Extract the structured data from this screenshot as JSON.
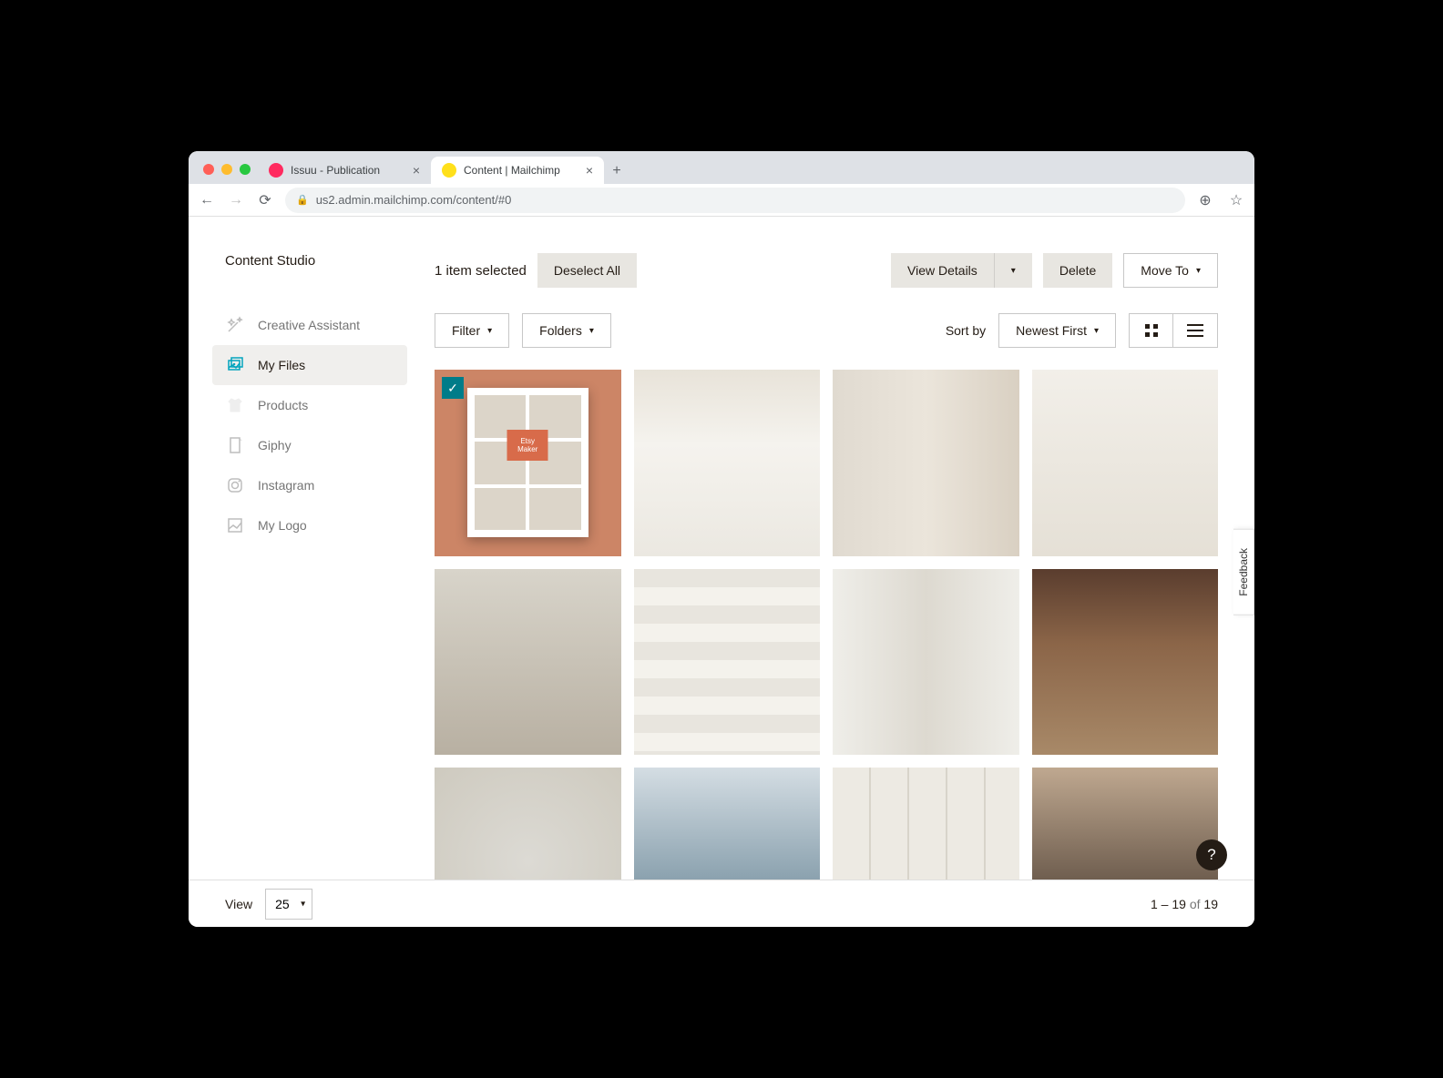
{
  "browser": {
    "tabs": [
      {
        "title": "Issuu - Publication",
        "favicon_color": "#ff2a5f",
        "active": false
      },
      {
        "title": "Content | Mailchimp",
        "favicon_color": "#ffe01b",
        "active": true
      }
    ],
    "url": "us2.admin.mailchimp.com/content/#0"
  },
  "page_title": "Content Studio",
  "sidebar": {
    "items": [
      {
        "label": "Creative Assistant",
        "icon": "wand-icon",
        "active": false
      },
      {
        "label": "My Files",
        "icon": "files-icon",
        "active": true
      },
      {
        "label": "Products",
        "icon": "shirt-icon",
        "active": false
      },
      {
        "label": "Giphy",
        "icon": "giphy-icon",
        "active": false
      },
      {
        "label": "Instagram",
        "icon": "instagram-icon",
        "active": false
      },
      {
        "label": "My Logo",
        "icon": "logo-icon",
        "active": false
      }
    ]
  },
  "toolbar": {
    "selected_text": "1 item selected",
    "deselect_label": "Deselect All",
    "view_details_label": "View Details",
    "delete_label": "Delete",
    "move_to_label": "Move To"
  },
  "filters": {
    "filter_label": "Filter",
    "folders_label": "Folders",
    "sort_by_label": "Sort by",
    "sort_value": "Newest First"
  },
  "grid": {
    "items": [
      {
        "selected": true,
        "img_class": "img-1"
      },
      {
        "selected": false,
        "img_class": "img-2"
      },
      {
        "selected": false,
        "img_class": "img-3"
      },
      {
        "selected": false,
        "img_class": "img-4"
      },
      {
        "selected": false,
        "img_class": "img-5"
      },
      {
        "selected": false,
        "img_class": "img-6"
      },
      {
        "selected": false,
        "img_class": "img-7"
      },
      {
        "selected": false,
        "img_class": "img-8"
      },
      {
        "selected": false,
        "img_class": "img-9"
      },
      {
        "selected": false,
        "img_class": "img-10"
      },
      {
        "selected": false,
        "img_class": "img-11"
      },
      {
        "selected": false,
        "img_class": "img-12"
      }
    ]
  },
  "footer": {
    "view_label": "View",
    "page_size": "25",
    "range_start": "1",
    "range_end": "19",
    "total": "19",
    "of_label": "of",
    "dash": " – "
  },
  "feedback_label": "Feedback",
  "help_label": "?"
}
